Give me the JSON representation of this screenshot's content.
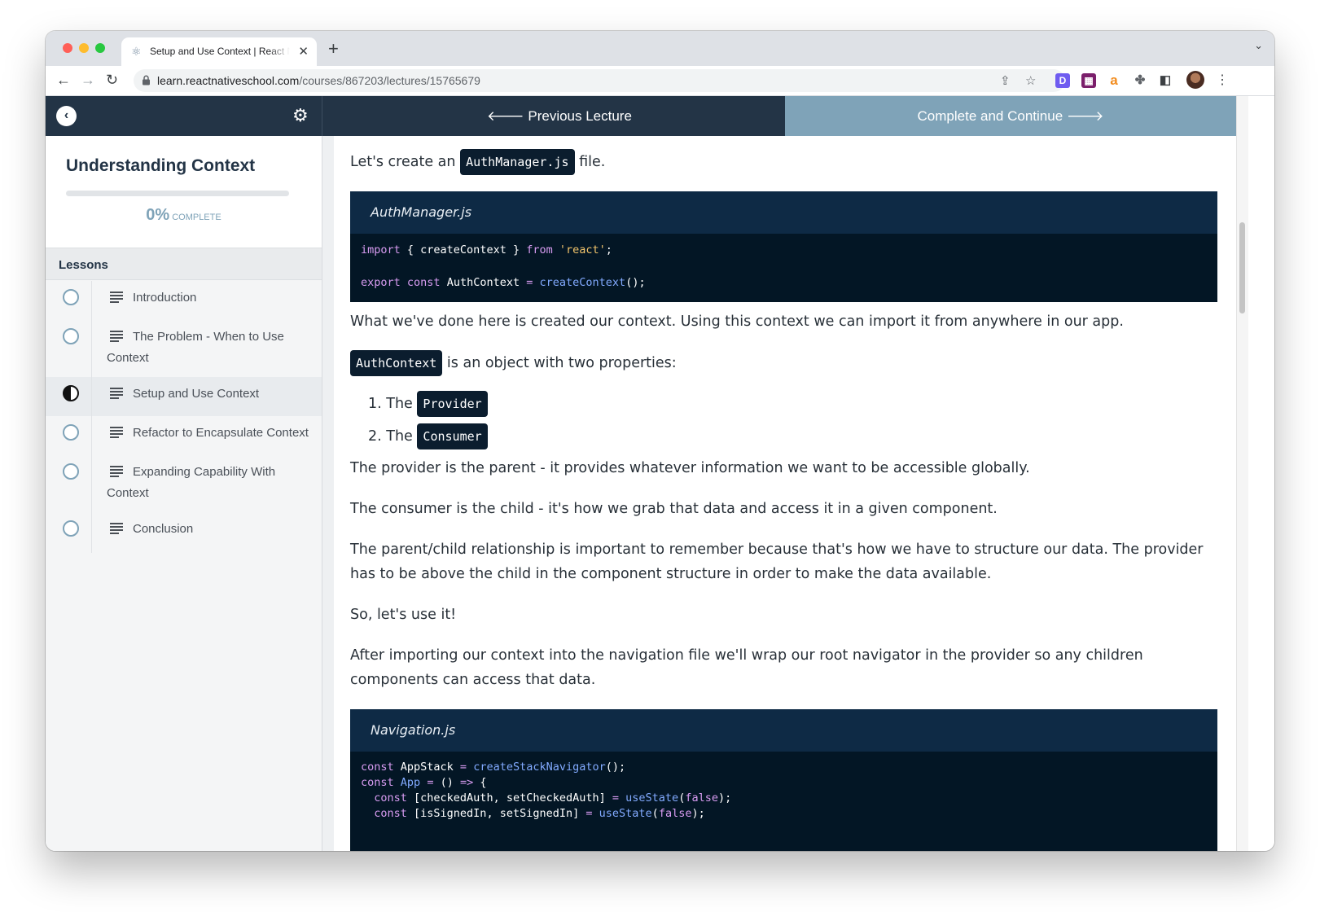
{
  "browser": {
    "tab_title": "Setup and Use Context | React Native School",
    "tab_close": "✕",
    "new_tab": "+",
    "url_domain": "learn.reactnativeschool.com",
    "url_path": "/courses/867203/lectures/15765679"
  },
  "topbar": {
    "previous_label": "🡐 Previous Lecture",
    "complete_label": "Complete and Continue 🡒"
  },
  "sidebar": {
    "course_title": "Understanding Context",
    "progress_fraction": 0,
    "progress_percent": "0%",
    "progress_word": "COMPLETE",
    "lessons_header": "Lessons",
    "lessons": [
      {
        "label": "Introduction",
        "status": "incomplete"
      },
      {
        "label": "The Problem - When to Use Context",
        "status": "incomplete"
      },
      {
        "label": "Setup and Use Context",
        "status": "current"
      },
      {
        "label": "Refactor to Encapsulate Context",
        "status": "incomplete"
      },
      {
        "label": "Expanding Capability With Context",
        "status": "incomplete"
      },
      {
        "label": "Conclusion",
        "status": "incomplete"
      }
    ]
  },
  "content": {
    "intro_before": "Let's create an",
    "intro_chip": "AuthManager.js",
    "intro_after": "file.",
    "code1_filename": "AuthManager.js",
    "para_context": "What we've done here is created our context. Using this context we can import it from anywhere in our app.",
    "authcontext_chip": "AuthContext",
    "authcontext_after": "is an object with two properties:",
    "list": [
      {
        "num": "1.",
        "the": "The",
        "chip": "Provider"
      },
      {
        "num": "2.",
        "the": "The",
        "chip": "Consumer"
      }
    ],
    "para_provider": "The provider is the parent - it provides whatever information we want to be accessible globally.",
    "para_consumer": "The consumer is the child - it's how we grab that data and access it in a given component.",
    "para_relationship": "The parent/child relationship is important to remember because that's how we have to structure our data. The provider has to be above the child in the component structure in order to make the data available.",
    "para_use": "So, let's use it!",
    "para_navigation": "After importing our context into the navigation file we'll wrap our root navigator in the provider so any children components can access that data.",
    "code2_filename": "Navigation.js"
  }
}
